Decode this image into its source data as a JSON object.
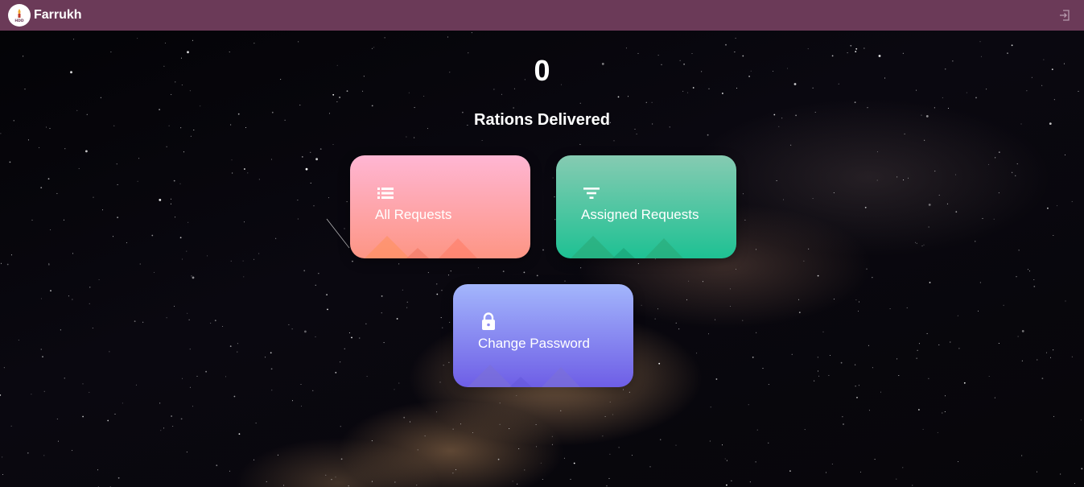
{
  "header": {
    "logo_icon": "hunger-logo-icon",
    "user_name": "Farrukh",
    "logout_icon": "logout-icon",
    "background_color": "#6b3a58"
  },
  "stats": {
    "count": "0",
    "label": "Rations Delivered"
  },
  "cards": {
    "all_requests": {
      "label": "All Requests",
      "icon": "list-icon",
      "gradient": [
        "#ffb6d3",
        "#fd9584"
      ]
    },
    "assigned_requests": {
      "label": "Assigned Requests",
      "icon": "filter-icon",
      "gradient": [
        "#86cbb2",
        "#1ec193"
      ]
    },
    "change_password": {
      "label": "Change Password",
      "icon": "lock-icon",
      "gradient": [
        "#a3b6fc",
        "#6e5ee6"
      ]
    }
  }
}
